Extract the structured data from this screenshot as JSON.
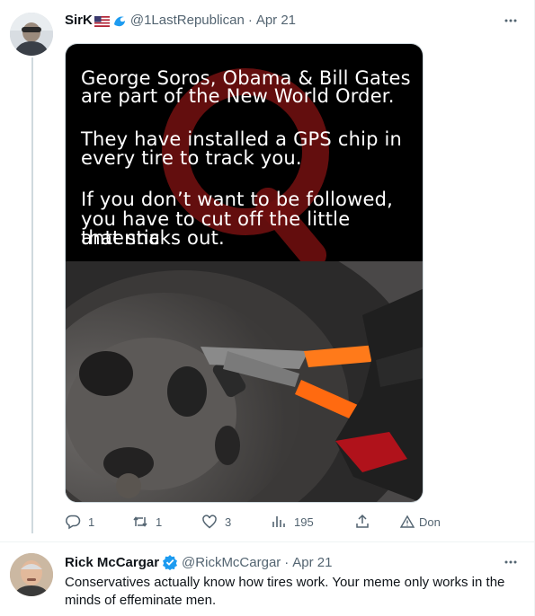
{
  "tweet1": {
    "name": "SirK",
    "handle": "@1LastRepublican",
    "date": "Apr 21",
    "meme_lines": [
      "George Soros, Obama & Bill Gates",
      "are part of the New World Order.",
      "They have installed a GPS chip in",
      "every tire to track you.",
      "If you don’t want to be followed,",
      "you have to cut off the little antenna",
      "that sticks out."
    ],
    "watermark_letter": "Q",
    "stats": {
      "replies": "1",
      "retweets": "1",
      "likes": "3",
      "views": "195",
      "extra": "Don"
    }
  },
  "tweet2": {
    "name": "Rick McCargar",
    "handle": "@RickMcCargar",
    "date": "Apr 21",
    "text": "Conservatives actually know how tires work. Your meme only works in the minds of effeminate men."
  },
  "separator": "·",
  "icons": {
    "more": "more-icon",
    "reply": "reply-icon",
    "retweet": "retweet-icon",
    "like": "heart-icon",
    "views": "views-icon",
    "share": "share-icon",
    "warning": "warning-icon",
    "verified": "verified-badge-icon",
    "flag": "us-flag-icon",
    "wave": "wave-icon"
  },
  "colors": {
    "text": "#0f1419",
    "secondary": "#536471",
    "verified": "#1d9bf0",
    "q_watermark": "#7a1010"
  }
}
